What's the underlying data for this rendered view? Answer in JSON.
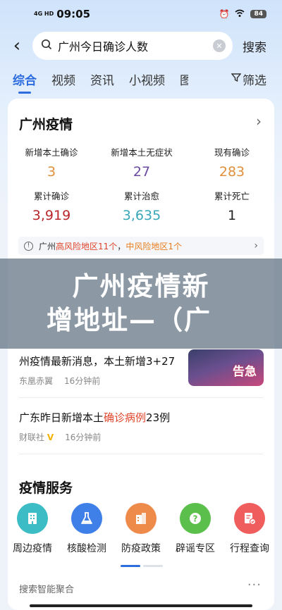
{
  "status_bar": {
    "signal": "4G HD",
    "time": "09:05",
    "battery": "84"
  },
  "search": {
    "value": "广州今日确诊人数",
    "button": "搜索"
  },
  "tabs": [
    "综合",
    "视频",
    "资讯",
    "小视频",
    "图"
  ],
  "filter_label": "筛选",
  "epidemic": {
    "title": "广州疫情",
    "stats": [
      {
        "label": "新增本土确诊",
        "value": "3",
        "color": "#e0903a"
      },
      {
        "label": "新增本土无症状",
        "value": "27",
        "color": "#6a4aa0"
      },
      {
        "label": "现有确诊",
        "value": "283",
        "color": "#e0903a"
      },
      {
        "label": "累计确诊",
        "value": "3,919",
        "color": "#b8262b"
      },
      {
        "label": "累计治愈",
        "value": "3,635",
        "color": "#3aa6b9"
      },
      {
        "label": "累计死亡",
        "value": "1",
        "color": "#222222"
      }
    ],
    "risk": {
      "prefix": "广州",
      "high": "高风险地区11个",
      "sep": "，",
      "mid": "中风险地区1个"
    }
  },
  "overlay": {
    "line1": "广州疫情新",
    "line2": "增地址—（广"
  },
  "news": [
    {
      "title": "州疫情最新消息，本土新增3+27",
      "thumb_tag": "告急",
      "source": "东凰赤翼",
      "time": "16分钟前"
    },
    {
      "title_prefix": "广东昨日新增本土",
      "title_highlight": "确诊病例",
      "title_suffix": "23例",
      "source": "财联社",
      "badge": "V",
      "time": "16分钟前"
    }
  ],
  "services": {
    "title": "疫情服务",
    "items": [
      {
        "label": "周边疫情",
        "icon": "building-icon",
        "color": "#3cbcc4"
      },
      {
        "label": "核酸检测",
        "icon": "flask-icon",
        "color": "#3f7fe8"
      },
      {
        "label": "防疫政策",
        "icon": "policy-icon",
        "color": "#ee8a4a"
      },
      {
        "label": "辟谣专区",
        "icon": "question-icon",
        "color": "#5bbf4b"
      },
      {
        "label": "行程查询",
        "icon": "itinerary-icon",
        "color": "#ef5d5d"
      }
    ]
  },
  "aggregation": "搜索智能聚合",
  "more": "···"
}
